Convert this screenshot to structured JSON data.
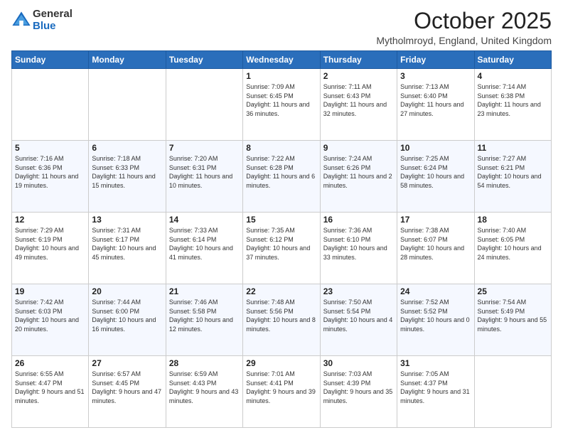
{
  "logo": {
    "general": "General",
    "blue": "Blue"
  },
  "title": "October 2025",
  "location": "Mytholmroyd, England, United Kingdom",
  "days_of_week": [
    "Sunday",
    "Monday",
    "Tuesday",
    "Wednesday",
    "Thursday",
    "Friday",
    "Saturday"
  ],
  "weeks": [
    [
      {
        "day": "",
        "info": ""
      },
      {
        "day": "",
        "info": ""
      },
      {
        "day": "",
        "info": ""
      },
      {
        "day": "1",
        "info": "Sunrise: 7:09 AM\nSunset: 6:45 PM\nDaylight: 11 hours\nand 36 minutes."
      },
      {
        "day": "2",
        "info": "Sunrise: 7:11 AM\nSunset: 6:43 PM\nDaylight: 11 hours\nand 32 minutes."
      },
      {
        "day": "3",
        "info": "Sunrise: 7:13 AM\nSunset: 6:40 PM\nDaylight: 11 hours\nand 27 minutes."
      },
      {
        "day": "4",
        "info": "Sunrise: 7:14 AM\nSunset: 6:38 PM\nDaylight: 11 hours\nand 23 minutes."
      }
    ],
    [
      {
        "day": "5",
        "info": "Sunrise: 7:16 AM\nSunset: 6:36 PM\nDaylight: 11 hours\nand 19 minutes."
      },
      {
        "day": "6",
        "info": "Sunrise: 7:18 AM\nSunset: 6:33 PM\nDaylight: 11 hours\nand 15 minutes."
      },
      {
        "day": "7",
        "info": "Sunrise: 7:20 AM\nSunset: 6:31 PM\nDaylight: 11 hours\nand 10 minutes."
      },
      {
        "day": "8",
        "info": "Sunrise: 7:22 AM\nSunset: 6:28 PM\nDaylight: 11 hours\nand 6 minutes."
      },
      {
        "day": "9",
        "info": "Sunrise: 7:24 AM\nSunset: 6:26 PM\nDaylight: 11 hours\nand 2 minutes."
      },
      {
        "day": "10",
        "info": "Sunrise: 7:25 AM\nSunset: 6:24 PM\nDaylight: 10 hours\nand 58 minutes."
      },
      {
        "day": "11",
        "info": "Sunrise: 7:27 AM\nSunset: 6:21 PM\nDaylight: 10 hours\nand 54 minutes."
      }
    ],
    [
      {
        "day": "12",
        "info": "Sunrise: 7:29 AM\nSunset: 6:19 PM\nDaylight: 10 hours\nand 49 minutes."
      },
      {
        "day": "13",
        "info": "Sunrise: 7:31 AM\nSunset: 6:17 PM\nDaylight: 10 hours\nand 45 minutes."
      },
      {
        "day": "14",
        "info": "Sunrise: 7:33 AM\nSunset: 6:14 PM\nDaylight: 10 hours\nand 41 minutes."
      },
      {
        "day": "15",
        "info": "Sunrise: 7:35 AM\nSunset: 6:12 PM\nDaylight: 10 hours\nand 37 minutes."
      },
      {
        "day": "16",
        "info": "Sunrise: 7:36 AM\nSunset: 6:10 PM\nDaylight: 10 hours\nand 33 minutes."
      },
      {
        "day": "17",
        "info": "Sunrise: 7:38 AM\nSunset: 6:07 PM\nDaylight: 10 hours\nand 28 minutes."
      },
      {
        "day": "18",
        "info": "Sunrise: 7:40 AM\nSunset: 6:05 PM\nDaylight: 10 hours\nand 24 minutes."
      }
    ],
    [
      {
        "day": "19",
        "info": "Sunrise: 7:42 AM\nSunset: 6:03 PM\nDaylight: 10 hours\nand 20 minutes."
      },
      {
        "day": "20",
        "info": "Sunrise: 7:44 AM\nSunset: 6:00 PM\nDaylight: 10 hours\nand 16 minutes."
      },
      {
        "day": "21",
        "info": "Sunrise: 7:46 AM\nSunset: 5:58 PM\nDaylight: 10 hours\nand 12 minutes."
      },
      {
        "day": "22",
        "info": "Sunrise: 7:48 AM\nSunset: 5:56 PM\nDaylight: 10 hours\nand 8 minutes."
      },
      {
        "day": "23",
        "info": "Sunrise: 7:50 AM\nSunset: 5:54 PM\nDaylight: 10 hours\nand 4 minutes."
      },
      {
        "day": "24",
        "info": "Sunrise: 7:52 AM\nSunset: 5:52 PM\nDaylight: 10 hours\nand 0 minutes."
      },
      {
        "day": "25",
        "info": "Sunrise: 7:54 AM\nSunset: 5:49 PM\nDaylight: 9 hours\nand 55 minutes."
      }
    ],
    [
      {
        "day": "26",
        "info": "Sunrise: 6:55 AM\nSunset: 4:47 PM\nDaylight: 9 hours\nand 51 minutes."
      },
      {
        "day": "27",
        "info": "Sunrise: 6:57 AM\nSunset: 4:45 PM\nDaylight: 9 hours\nand 47 minutes."
      },
      {
        "day": "28",
        "info": "Sunrise: 6:59 AM\nSunset: 4:43 PM\nDaylight: 9 hours\nand 43 minutes."
      },
      {
        "day": "29",
        "info": "Sunrise: 7:01 AM\nSunset: 4:41 PM\nDaylight: 9 hours\nand 39 minutes."
      },
      {
        "day": "30",
        "info": "Sunrise: 7:03 AM\nSunset: 4:39 PM\nDaylight: 9 hours\nand 35 minutes."
      },
      {
        "day": "31",
        "info": "Sunrise: 7:05 AM\nSunset: 4:37 PM\nDaylight: 9 hours\nand 31 minutes."
      },
      {
        "day": "",
        "info": ""
      }
    ]
  ]
}
